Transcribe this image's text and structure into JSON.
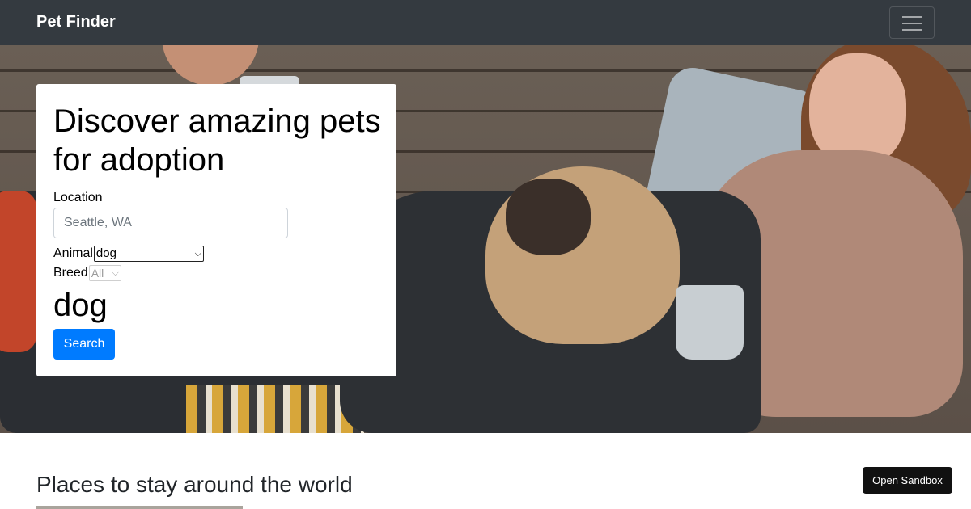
{
  "navbar": {
    "brand": "Pet Finder",
    "toggler_icon": "hamburger-menu-icon",
    "background": "#343a40"
  },
  "hero": {
    "image_subject": "people relaxing with a pug on a wooden porch"
  },
  "search_card": {
    "title": "Discover amazing pets for adoption",
    "location_label": "Location",
    "location_placeholder": "Seattle, WA",
    "animal_label": "Animal",
    "animal_selected": "dog",
    "breed_label": "Breed",
    "breed_selected": "All",
    "animal_display": "dog",
    "search_button": "Search",
    "accent_color": "#007bff"
  },
  "places": {
    "title": "Places to stay around the world"
  },
  "sandbox_button": "Open Sandbox"
}
